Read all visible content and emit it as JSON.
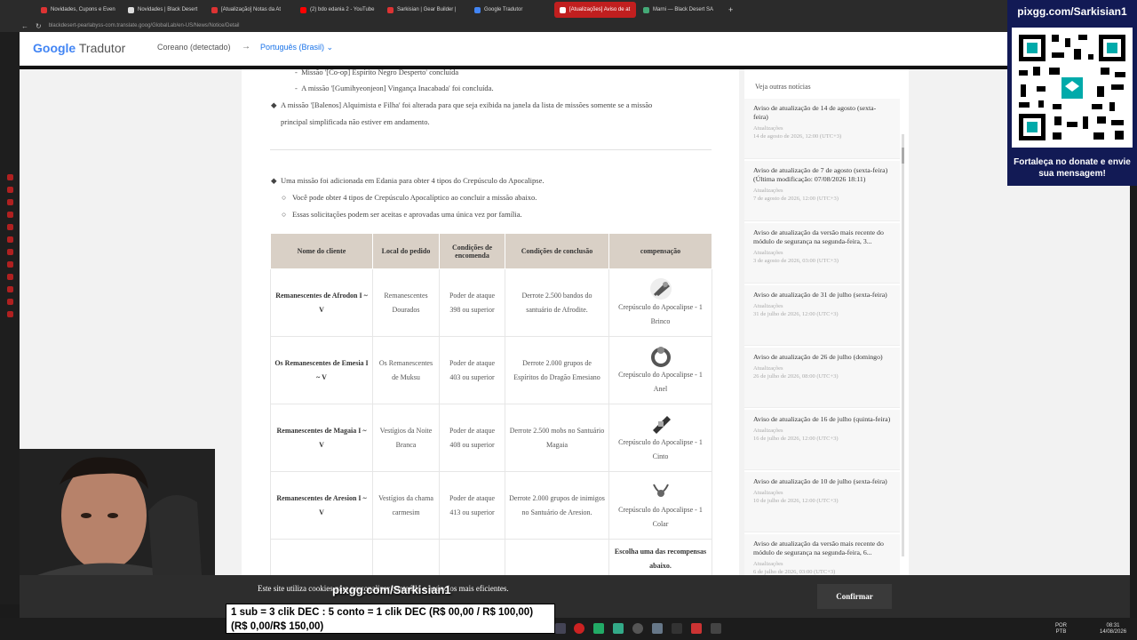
{
  "browser": {
    "tabs": [
      {
        "label": "Novidades, Cupons e Even",
        "active": false
      },
      {
        "label": "Novidades | Black Desert",
        "active": false
      },
      {
        "label": "[Atualização] Notas da At",
        "active": false
      },
      {
        "label": "(2) bdo edania 2 - YouTube",
        "active": false
      },
      {
        "label": "Sarkisian | Gear Builder |",
        "active": false
      },
      {
        "label": "Google Tradutor",
        "active": false
      },
      {
        "label": "[Atualizações] Aviso de at",
        "active": true
      },
      {
        "label": "Marni — Black Desert SA",
        "active": false
      }
    ],
    "new_tab": "+",
    "url": "blackdesert-pearlabyss-com.translate.goog/GlobalLab/en-US/News/Notice/Detail"
  },
  "translator": {
    "logo_google": "Google",
    "logo_product": "Tradutor",
    "source_lang": "Coreano (detectado)",
    "arrow": "→",
    "target_lang": "Português (Brasil)"
  },
  "article": {
    "top_lines": [
      "Missão '[Co-op] Espírito Negro Desperto' concluída",
      "A missão '[Gumihyeonjeon] Vingança Inacabada' foi concluída."
    ],
    "balenos_line1": "A missão '[Balenos] Alquimista e Filha' foi alterada para que seja exibida na janela da lista de missões somente se a missão",
    "balenos_line2": "principal simplificada não estiver em andamento.",
    "edania_intro": "Uma missão foi adicionada em Edania para obter 4 tipos do Crepúsculo do Apocalipse.",
    "edania_sub1": "Você pode obter 4 tipos de Crepúsculo Apocalíptico ao concluir a missão abaixo.",
    "edania_sub2": "Essas solicitações podem ser aceitas e aprovadas uma única vez por família.",
    "table": {
      "headers": [
        "Nome do cliente",
        "Local do pedido",
        "Condições de encomenda",
        "Condições de conclusão",
        "compensação"
      ],
      "rows": [
        {
          "client": "Remanescentes de Afrodon I ~ V",
          "location": "Remanescentes Dourados",
          "order": "Poder de ataque 398 ou superior",
          "completion": "Derrote 2.500 bandos do santuário de Afrodite.",
          "reward": "Crepúsculo do Apocalipse - 1 Brinco",
          "icon": "earring-icon"
        },
        {
          "client": "Os Remanescentes de Emesia I ~ V",
          "location": "Os Remanescentes de Muksu",
          "order": "Poder de ataque 403 ou superior",
          "completion": "Derrote 2.000 grupos de Espíritos do Dragão Emesiano",
          "reward": "Crepúsculo do Apocalipse - 1 Anel",
          "icon": "ring-icon"
        },
        {
          "client": "Remanescentes de Magaia I ~ V",
          "location": "Vestígios da Noite Branca",
          "order": "Poder de ataque 408 ou superior",
          "completion": "Derrote 2.500 mobs no Santuário Magaia",
          "reward": "Crepúsculo do Apocalipse - 1 Cinto",
          "icon": "belt-icon"
        },
        {
          "client": "Remanescentes de Aresion I ~ V",
          "location": "Vestígios da chama carmesim",
          "order": "Poder de ataque 413 ou superior",
          "completion": "Derrote 2.000 grupos de inimigos no Santuário de Aresion.",
          "reward": "Crepúsculo do Apocalipse - 1 Colar",
          "icon": "necklace-icon"
        }
      ],
      "last_row_reward": "Escolha uma das recompensas abaixo."
    }
  },
  "sidebar": {
    "title": "Veja outras notícias",
    "items": [
      {
        "title": "Aviso de atualização de 14 de agosto (sexta-feira)",
        "category": "Atualizações",
        "date": "14 de agosto de 2026, 12:00 (UTC+3)"
      },
      {
        "title": "Aviso de atualização de 7 de agosto (sexta-feira) (Última modificação: 07/08/2026 18:11)",
        "category": "Atualizações",
        "date": "7 de agosto de 2026, 12:00 (UTC+3)"
      },
      {
        "title": "Aviso de atualização da versão mais recente do módulo de segurança na segunda-feira, 3...",
        "category": "Atualizações",
        "date": "3 de agosto de 2026, 03:00 (UTC+3)"
      },
      {
        "title": "Aviso de atualização de 31 de julho (sexta-feira)",
        "category": "Atualizações",
        "date": "31 de julho de 2026, 12:00 (UTC+3)"
      },
      {
        "title": "Aviso de atualização de 26 de julho (domingo)",
        "category": "Atualizações",
        "date": "26 de julho de 2026, 08:00 (UTC+3)"
      },
      {
        "title": "Aviso de atualização de 16 de julho (quinta-feira)",
        "category": "Atualizações",
        "date": "16 de julho de 2026, 12:00 (UTC+3)"
      },
      {
        "title": "Aviso de atualização de 10 de julho (sexta-feira)",
        "category": "Atualizações",
        "date": "10 de julho de 2026, 12:00 (UTC+3)"
      },
      {
        "title": "Aviso de atualização da versão mais recente do módulo de segurança na segunda-feira, 6...",
        "category": "Atualizações",
        "date": "6 de julho de 2026, 03:00 (UTC+3)"
      }
    ]
  },
  "cookie": {
    "text": "Este site utiliza cookies para personalizar conteúdo e anúncios mais eficientes.",
    "confirm": "Confirmar"
  },
  "stream": {
    "qr_top": "pixgg.com/Sarkisian1",
    "qr_bottom": "Fortaleça no donate e envie sua mensagem!",
    "overlay_name": "pixgg.com/Sarkisian1",
    "sub_text": "1 sub = 3 clik DEC : 5 conto = 1 clik DEC (R$ 00,00 / R$ 100,00) (R$ 0,00/R$ 150,00)"
  },
  "taskbar": {
    "lang_top": "POR",
    "lang_bottom": "PTB",
    "time": "08:31",
    "date": "14/08/2026"
  },
  "colors": {
    "active_tab": "#c11f1f",
    "table_header": "#d9d0c6",
    "qr_panel": "#121a55",
    "link_blue": "#1a73e8"
  }
}
